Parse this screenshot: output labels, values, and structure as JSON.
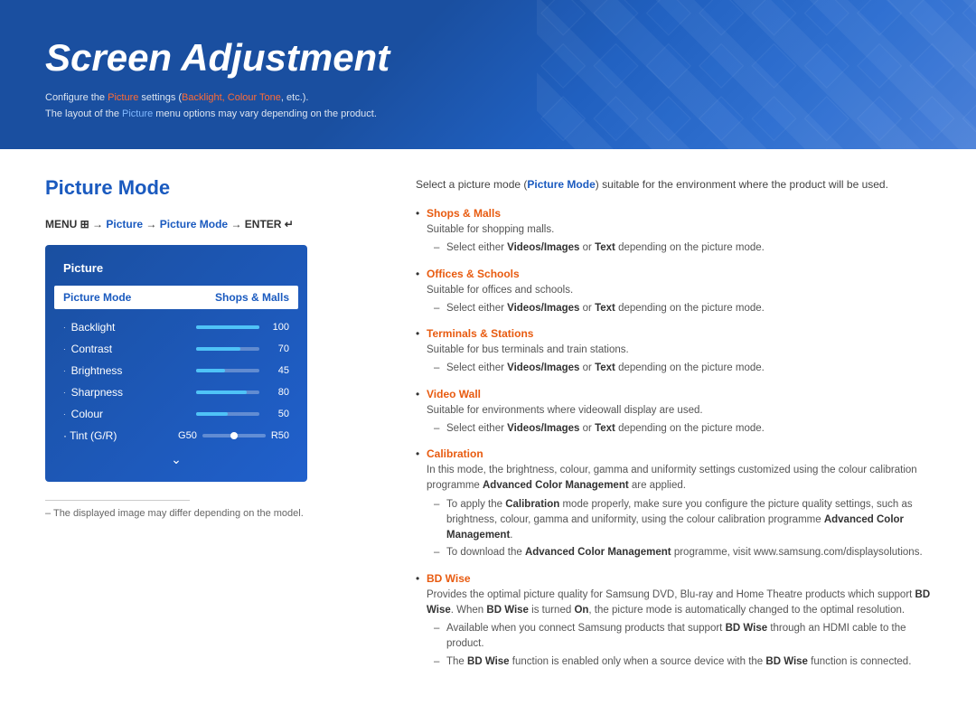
{
  "header": {
    "title": "Screen Adjustment",
    "subtitle_line1": "Configure the Picture settings (Backlight, Colour Tone, etc.).",
    "subtitle_line2": "The layout of the Picture menu options may vary depending on the product."
  },
  "section": {
    "title": "Picture Mode",
    "menu_path": "MENU  → Picture → Picture Mode → ENTER "
  },
  "picture_menu": {
    "title": "Picture",
    "selected_label": "Picture Mode",
    "selected_value": "Shops & Malls",
    "rows": [
      {
        "label": "Backlight",
        "value": 100,
        "percent": 100
      },
      {
        "label": "Contrast",
        "value": 70,
        "percent": 70
      },
      {
        "label": "Brightness",
        "value": 45,
        "percent": 45
      },
      {
        "label": "Sharpness",
        "value": 80,
        "percent": 80
      },
      {
        "label": "Colour",
        "value": 50,
        "percent": 50
      }
    ],
    "tint_label": "Tint (G/R)",
    "tint_g": "G50",
    "tint_r": "R50"
  },
  "right_content": {
    "intro": "Select a picture mode (Picture Mode) suitable for the environment where the product will be used.",
    "items": [
      {
        "title": "Shops & Malls",
        "desc": "Suitable for shopping malls.",
        "sub_items": [
          "Select either Videos/Images or Text depending on the picture mode."
        ]
      },
      {
        "title": "Offices & Schools",
        "desc": "Suitable for offices and schools.",
        "sub_items": [
          "Select either Videos/Images or Text depending on the picture mode."
        ]
      },
      {
        "title": "Terminals & Stations",
        "desc": "Suitable for bus terminals and train stations.",
        "sub_items": [
          "Select either Videos/Images or Text depending on the picture mode."
        ]
      },
      {
        "title": "Video Wall",
        "desc": "Suitable for environments where videowall display are used.",
        "sub_items": [
          "Select either Videos/Images or Text depending on the picture mode."
        ]
      },
      {
        "title": "Calibration",
        "desc": "In this mode, the brightness, colour, gamma and uniformity settings customized using the colour calibration programme Advanced Color Management are applied.",
        "sub_items": [
          "To apply the Calibration mode properly, make sure you configure the picture quality settings, such as brightness, colour, gamma and uniformity, using the colour calibration programme Advanced Color Management.",
          "To download the Advanced Color Management programme, visit www.samsung.com/displaysolutions."
        ]
      },
      {
        "title": "BD Wise",
        "desc": "Provides the optimal picture quality for Samsung DVD, Blu-ray and Home Theatre products which support BD Wise. When BD Wise is turned On, the picture mode is automatically changed to the optimal resolution.",
        "sub_items": [
          "Available when you connect Samsung products that support BD Wise through an HDMI cable to the product.",
          "The BD Wise function is enabled only when a source device with the BD Wise function is connected."
        ]
      }
    ]
  },
  "footer_note": "– The displayed image may differ depending on the model."
}
